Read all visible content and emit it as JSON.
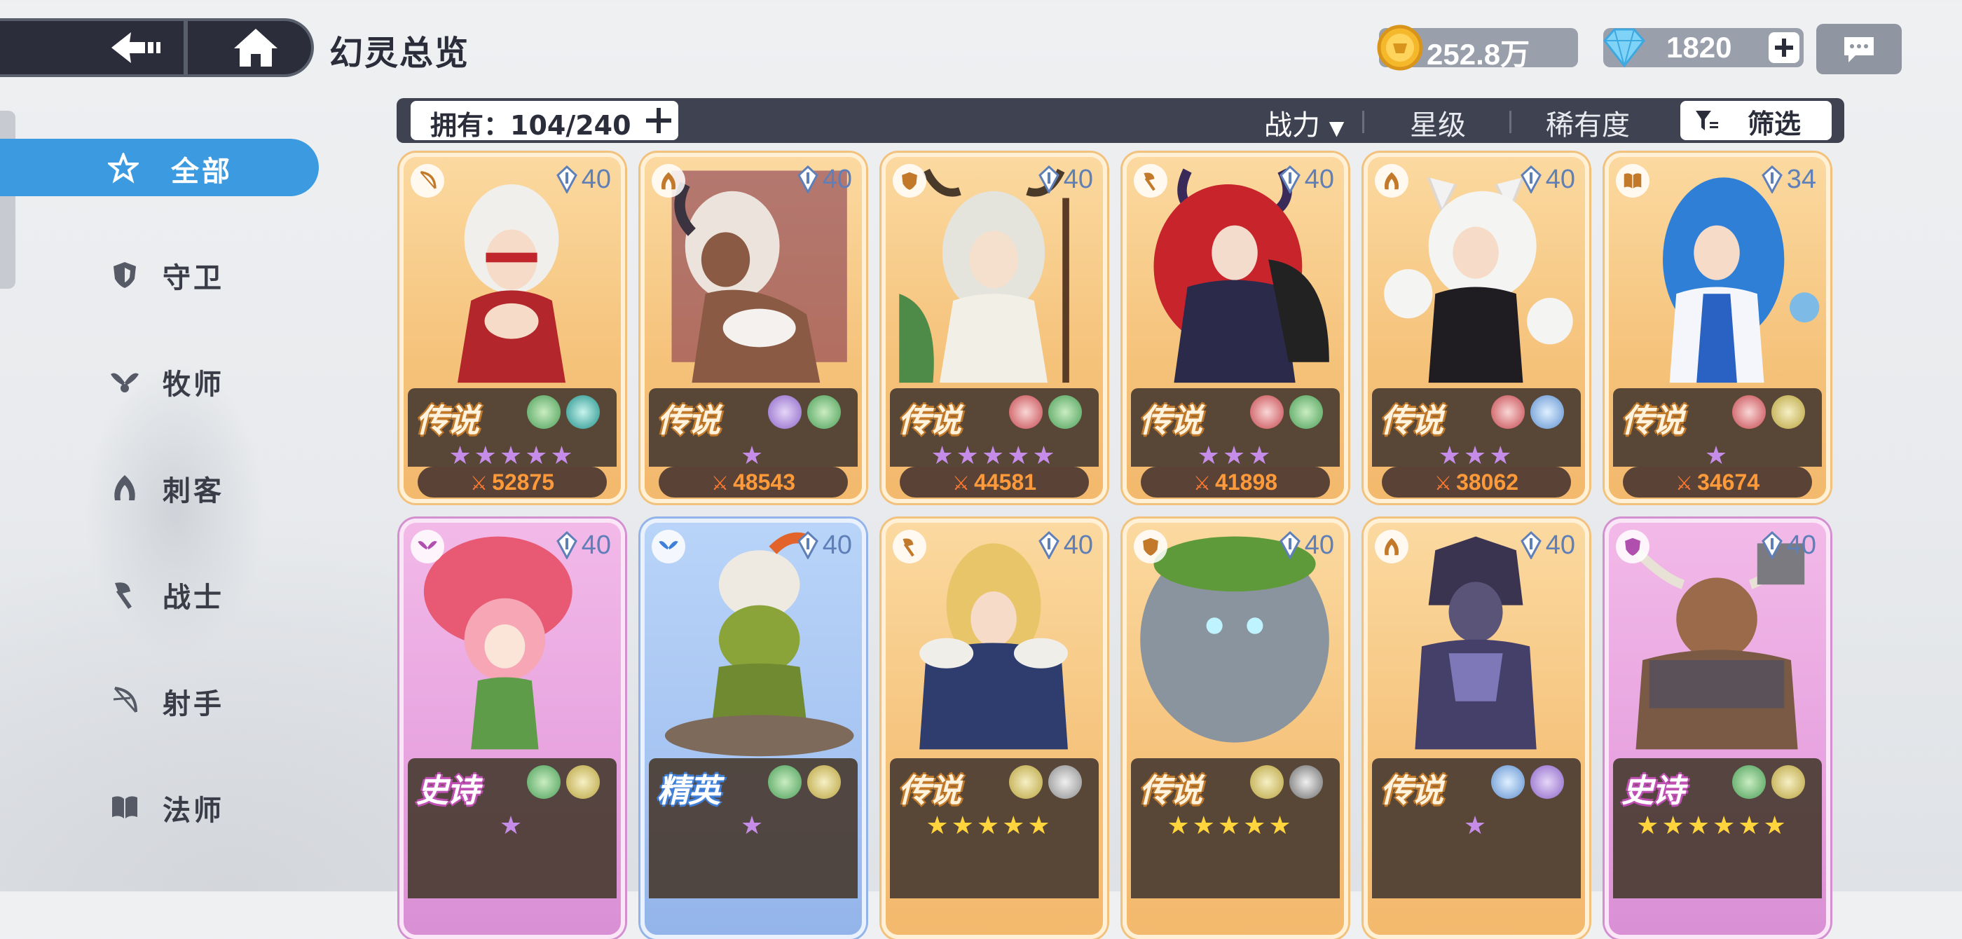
{
  "header": {
    "title": "幻灵总览",
    "gold": "252.8万",
    "gems": "1820"
  },
  "sidebar": {
    "items": [
      {
        "label": "全部",
        "active": true,
        "icon": "star-outline-icon"
      },
      {
        "label": "守卫",
        "active": false,
        "icon": "shield-icon"
      },
      {
        "label": "牧师",
        "active": false,
        "icon": "wings-icon"
      },
      {
        "label": "刺客",
        "active": false,
        "icon": "assassin-icon"
      },
      {
        "label": "战士",
        "active": false,
        "icon": "axe-icon"
      },
      {
        "label": "射手",
        "active": false,
        "icon": "bow-icon"
      },
      {
        "label": "法师",
        "active": false,
        "icon": "book-icon"
      }
    ]
  },
  "filterbar": {
    "owned": "拥有：104/240",
    "sort_power": "战力",
    "sort_star": "星级",
    "sort_rarity": "稀有度",
    "filter": "筛选"
  },
  "cards": [
    {
      "rarity": "传说",
      "level": "40",
      "stars": "★★★★★",
      "power": "52875"
    },
    {
      "rarity": "传说",
      "level": "40",
      "stars": "★",
      "power": "48543"
    },
    {
      "rarity": "传说",
      "level": "40",
      "stars": "★★★★★",
      "power": "44581"
    },
    {
      "rarity": "传说",
      "level": "40",
      "stars": "★★★",
      "power": "41898"
    },
    {
      "rarity": "传说",
      "level": "40",
      "stars": "★★★",
      "power": "38062"
    },
    {
      "rarity": "传说",
      "level": "34",
      "stars": "★",
      "power": "34674"
    },
    {
      "rarity": "史诗",
      "level": "40",
      "stars": "★"
    },
    {
      "rarity": "精英",
      "level": "40",
      "stars": "★"
    },
    {
      "rarity": "传说",
      "level": "40",
      "stars": "★★★★★"
    },
    {
      "rarity": "传说",
      "level": "40",
      "stars": "★★★★★"
    },
    {
      "rarity": "传说",
      "level": "40",
      "stars": "★"
    },
    {
      "rarity": "史诗",
      "level": "40",
      "stars": "★★★★★★"
    }
  ],
  "colors": {
    "accent": "#3c9be0",
    "bar": "#3f4250",
    "power_text": "#ff9a3a"
  }
}
